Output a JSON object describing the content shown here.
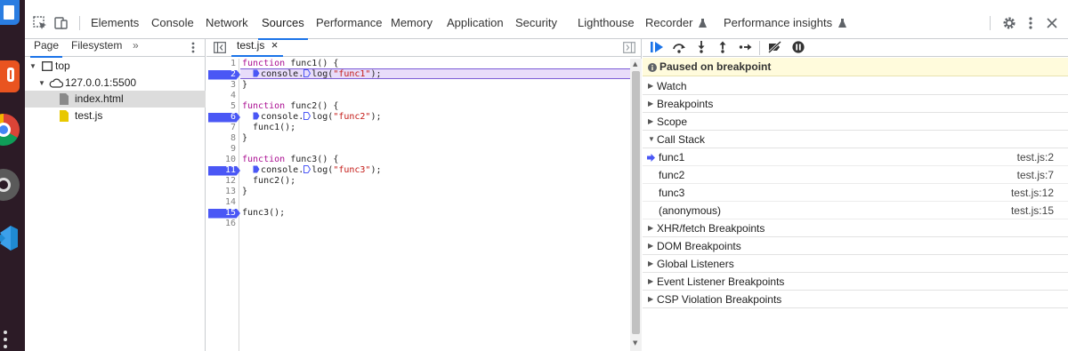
{
  "tabbar": {
    "tabs": [
      {
        "label": "Elements"
      },
      {
        "label": "Console"
      },
      {
        "label": "Network"
      },
      {
        "label": "Sources",
        "active": true
      },
      {
        "label": "Performance"
      },
      {
        "label": "Memory"
      },
      {
        "label": "Application"
      },
      {
        "label": "Security"
      },
      {
        "label": "Lighthouse"
      },
      {
        "label": "Recorder"
      },
      {
        "label": "Performance insights"
      }
    ],
    "icons": [
      "inspect-element-icon",
      "device-toolbar-icon",
      "flask-icon",
      "settings-gear-icon",
      "more-vertical-icon",
      "close-icon"
    ]
  },
  "navigator": {
    "tabs": [
      "Page",
      "Filesystem"
    ],
    "more_glyph": "»",
    "tree": [
      {
        "label": "top",
        "icon": "frame-icon"
      },
      {
        "label": "127.0.0.1:5500",
        "icon": "cloud-icon"
      },
      {
        "label": "index.html",
        "icon": "html-file-icon",
        "selected": true
      },
      {
        "label": "test.js",
        "icon": "js-file-icon"
      }
    ]
  },
  "editor": {
    "tab_label": "test.js",
    "close_glyph": "×",
    "lines": [
      {
        "n": "1",
        "text": "function func1() {"
      },
      {
        "n": "2",
        "text": "  console.log(\"func1\");"
      },
      {
        "n": "3",
        "text": "}"
      },
      {
        "n": "4",
        "text": ""
      },
      {
        "n": "5",
        "text": "function func2() {"
      },
      {
        "n": "6",
        "text": "  console.log(\"func2\");"
      },
      {
        "n": "7",
        "text": "  func1();"
      },
      {
        "n": "8",
        "text": "}"
      },
      {
        "n": "9",
        "text": ""
      },
      {
        "n": "10",
        "text": "function func3() {"
      },
      {
        "n": "11",
        "text": "  console.log(\"func3\");"
      },
      {
        "n": "12",
        "text": "  func2();"
      },
      {
        "n": "13",
        "text": "}"
      },
      {
        "n": "14",
        "text": ""
      },
      {
        "n": "15",
        "text": "func3();"
      },
      {
        "n": "16",
        "text": ""
      }
    ],
    "breakpoint_lines": [
      "2",
      "6",
      "11",
      "15"
    ],
    "execution_line": "2"
  },
  "debugger": {
    "toolbar_icons": [
      "resume-icon",
      "step-over-icon",
      "step-into-icon",
      "step-out-icon",
      "step-icon",
      "deactivate-breakpoints-icon",
      "pause-on-exceptions-icon"
    ],
    "paused_text": "Paused on breakpoint",
    "sections_before": [
      {
        "label": "Watch",
        "expanded": false
      },
      {
        "label": "Breakpoints",
        "expanded": false
      },
      {
        "label": "Scope",
        "expanded": false
      },
      {
        "label": "Call Stack",
        "expanded": true
      }
    ],
    "call_stack": [
      {
        "name": "func1",
        "location": "test.js:2",
        "current": true
      },
      {
        "name": "func2",
        "location": "test.js:7"
      },
      {
        "name": "func3",
        "location": "test.js:12"
      },
      {
        "name": "(anonymous)",
        "location": "test.js:15"
      }
    ],
    "sections_after": [
      {
        "label": "XHR/fetch Breakpoints"
      },
      {
        "label": "DOM Breakpoints"
      },
      {
        "label": "Global Listeners"
      },
      {
        "label": "Event Listener Breakpoints"
      },
      {
        "label": "CSP Violation Breakpoints"
      }
    ]
  },
  "colors": {
    "accent": "#1a73e8",
    "breakpoint": "#4a57f5",
    "execution_highlight": "#e8dcfa",
    "paused_banner": "#fffbdc",
    "keyword": "#aa0d91",
    "string": "#c41a16"
  }
}
